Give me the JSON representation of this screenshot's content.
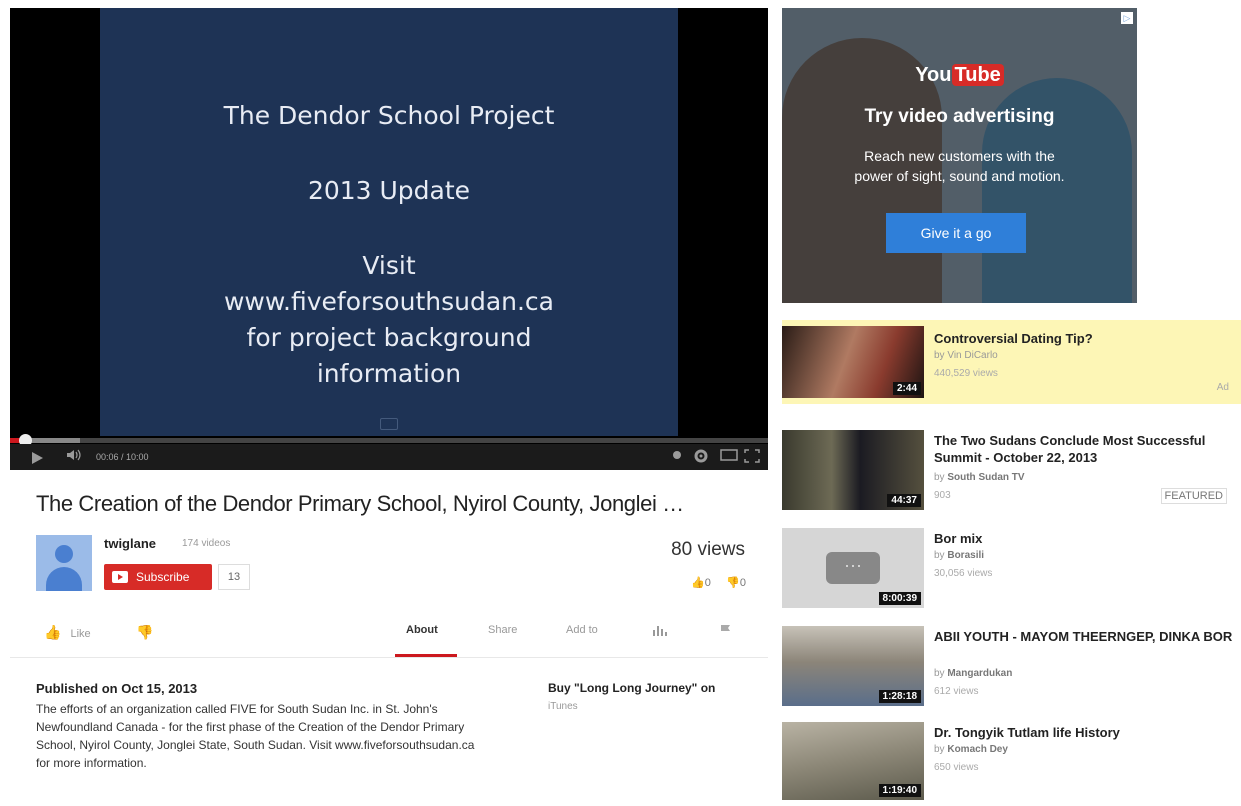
{
  "player": {
    "slide_line1": "The Dendor School Project",
    "slide_line2": "2013 Update",
    "slide_line3a": "Visit",
    "slide_line3b": "www.fiveforsouthsudan.ca",
    "slide_line3c": "for project background",
    "slide_line3d": "information",
    "time": "00:06 / 10:00",
    "progress_fraction": 0.02
  },
  "video": {
    "title": "The Creation of the Dendor Primary School, Nyirol County, Jonglei …",
    "channel": "twiglane",
    "video_count": "174 videos",
    "subscribe_label": "Subscribe",
    "subscriber_count": "13",
    "views": "80 views",
    "likes": "0",
    "dislikes": "0"
  },
  "actions": {
    "like": "Like",
    "about": "About",
    "share": "Share",
    "add_to": "Add to"
  },
  "description": {
    "published": "Published on Oct 15, 2013",
    "text": "The efforts of an organization called FIVE for South Sudan Inc. in St. John's Newfoundland Canada - for the first phase of the Creation of the Dendor Primary School, Nyirol County, Jonglei State, South Sudan. Visit www.fiveforsouthsudan.ca for more information.",
    "buy_title": "Buy \"Long Long Journey\" on",
    "buy_source": "iTunes"
  },
  "ad": {
    "logo_you": "You",
    "logo_tube": "Tube",
    "headline": "Try video advertising",
    "sub_line1": "Reach new customers with the",
    "sub_line2": "power of sight, sound and motion.",
    "cta": "Give it a go",
    "info_icon": "▷"
  },
  "related": [
    {
      "title": "Controversial Dating Tip?",
      "by_prefix": "by",
      "author": "Vin DiCarlo",
      "views": "440,529 views",
      "duration": "2:44",
      "tag": "Ad"
    },
    {
      "title": "The Two Sudans Conclude Most Successful Summit - October 22, 2013",
      "by_prefix": "by",
      "author": "South Sudan TV",
      "views": "903",
      "duration": "44:37",
      "tag": "FEATURED"
    },
    {
      "title": "Bor mix",
      "by_prefix": "by",
      "author": "Borasili",
      "views": "30,056 views",
      "duration": "8:00:39"
    },
    {
      "title": "ABII YOUTH - MAYOM THEERNGEP, DINKA BOR",
      "by_prefix": "by",
      "author": "Mangardukan",
      "views": "612 views",
      "duration": "1:28:18"
    },
    {
      "title": "Dr. Tongyik Tutlam life History",
      "by_prefix": "by",
      "author": "Komach Dey",
      "views": "650 views",
      "duration": "1:19:40"
    }
  ]
}
